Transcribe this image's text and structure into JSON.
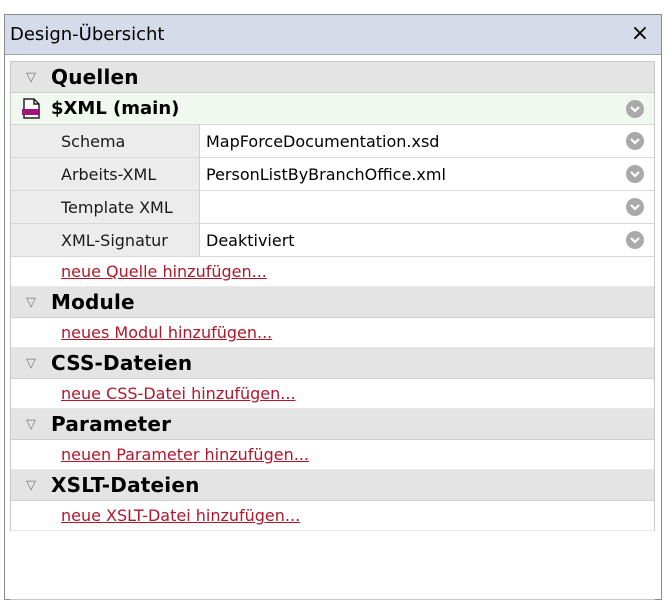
{
  "window": {
    "title": "Design-Übersicht",
    "close_glyph": "×"
  },
  "sections": {
    "quellen": {
      "title": "Quellen",
      "toggle_glyph": "▽",
      "source": {
        "name": "$XML (main)",
        "icon": "xml-file-icon",
        "properties": [
          {
            "label": "Schema",
            "value": "MapForceDocumentation.xsd"
          },
          {
            "label": "Arbeits-XML",
            "value": "PersonListByBranchOffice.xml"
          },
          {
            "label": "Template XML",
            "value": ""
          },
          {
            "label": "XML-Signatur",
            "value": "Deaktiviert"
          }
        ]
      },
      "add_link": "neue Quelle hinzufügen..."
    },
    "module": {
      "title": "Module",
      "toggle_glyph": "▽",
      "add_link": "neues Modul hinzufügen..."
    },
    "css": {
      "title": "CSS-Dateien",
      "toggle_glyph": "▽",
      "add_link": "neue CSS-Datei hinzufügen..."
    },
    "parameter": {
      "title": "Parameter",
      "toggle_glyph": "▽",
      "add_link": "neuen Parameter hinzufügen..."
    },
    "xslt": {
      "title": "XSLT-Dateien",
      "toggle_glyph": "▽",
      "add_link": "neue XSLT-Datei hinzufügen..."
    }
  },
  "colors": {
    "title_bar": "#d6dbe9",
    "section_header": "#e4e4e4",
    "source_row": "#f1f8ef",
    "link": "#b0172a",
    "circle_button": "#a9a9a9",
    "icon_accent": "#a0157a"
  }
}
